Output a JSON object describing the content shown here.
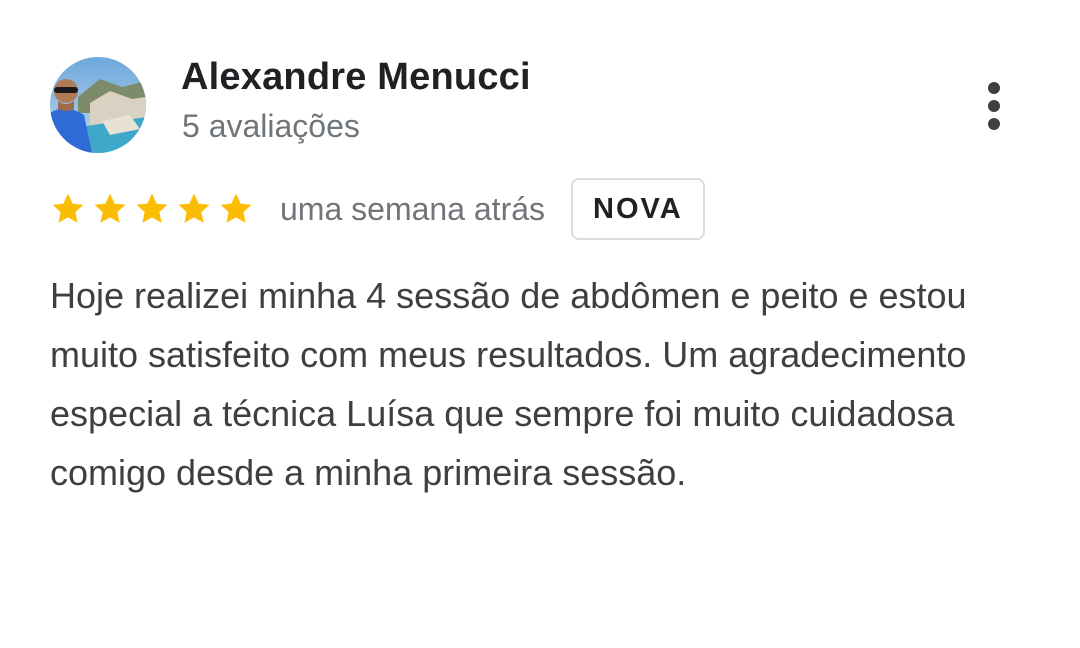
{
  "review": {
    "author": {
      "name": "Alexandre Menucci",
      "review_count": "5 avaliações",
      "avatar_icon": "user-avatar-photo"
    },
    "rating": {
      "stars": 5,
      "max_stars": 5,
      "star_color": "#fbbc04"
    },
    "time": "uma semana atrás",
    "badge": "NOVA",
    "text": "Hoje realizei minha 4 sessão de abdômen e peito e estou muito satisfeito com meus resultados. Um agradecimento especial a técnica Luísa que sempre foi muito cuidadosa comigo desde a minha primeira sessão.",
    "menu_icon": "more-vertical-icon"
  },
  "colors": {
    "name": "#202124",
    "secondary_text": "#70757a",
    "body_text": "#3c4043",
    "badge_border": "#dadce0"
  }
}
